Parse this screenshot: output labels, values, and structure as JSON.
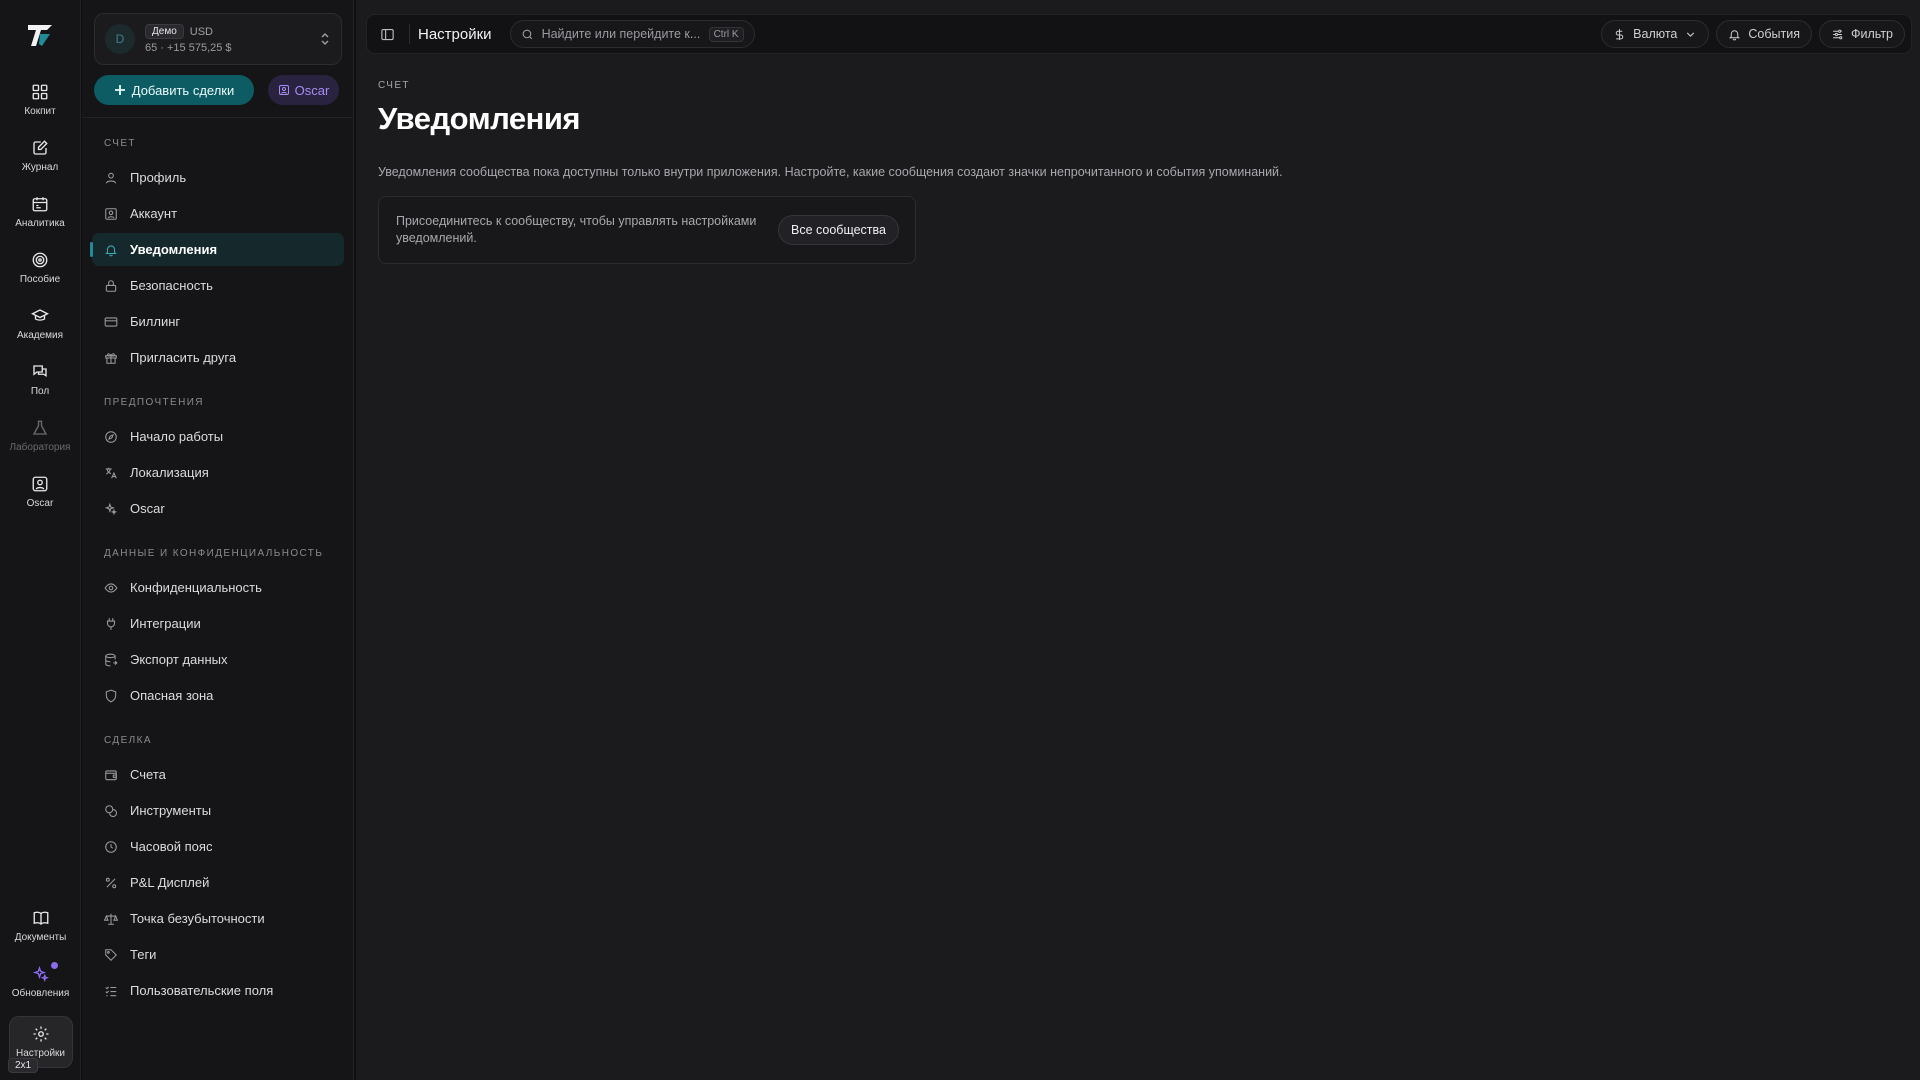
{
  "rail": {
    "items": [
      {
        "label": "Кокпит",
        "icon": "dashboard-icon"
      },
      {
        "label": "Журнал",
        "icon": "journal-icon"
      },
      {
        "label": "Аналитика",
        "icon": "calendar-icon"
      },
      {
        "label": "Пособие",
        "icon": "target-icon"
      },
      {
        "label": "Академия",
        "icon": "graduation-cap-icon"
      },
      {
        "label": "Пол",
        "icon": "chat-icon"
      },
      {
        "label": "Лаборатория",
        "icon": "flask-icon"
      },
      {
        "label": "Oscar",
        "icon": "oscar-icon"
      }
    ],
    "bottom": [
      {
        "label": "Документы",
        "icon": "book-icon"
      },
      {
        "label": "Обновления",
        "icon": "sparkles-icon"
      },
      {
        "label": "Настройки",
        "icon": "gear-icon"
      }
    ],
    "zoom_badge": "2x1"
  },
  "account": {
    "avatar_letter": "D",
    "mode": "Демо",
    "currency": "USD",
    "summary": "65 · +15 575,25 $"
  },
  "actions": {
    "add_trades": "Добавить сделки",
    "oscar": "Oscar"
  },
  "sidebar": {
    "sections": [
      {
        "title": "Счет",
        "items": [
          "Профиль",
          "Аккаунт",
          "Уведомления",
          "Безопасность",
          "Биллинг",
          "Пригласить друга"
        ]
      },
      {
        "title": "Предпочтения",
        "items": [
          "Начало работы",
          "Локализация",
          "Oscar"
        ]
      },
      {
        "title": "Данные и конфиденциальность",
        "items": [
          "Конфиденциальность",
          "Интеграции",
          "Экспорт данных",
          "Опасная зона"
        ]
      },
      {
        "title": "Сделка",
        "items": [
          "Счета",
          "Инструменты",
          "Часовой пояс",
          "P&L Дисплей",
          "Точка безубыточности",
          "Теги",
          "Пользовательские поля"
        ]
      }
    ],
    "active_item": "Уведомления"
  },
  "topbar": {
    "title": "Настройки",
    "search_placeholder": "Найдите или перейдите к...",
    "search_shortcut": "Ctrl K",
    "currency": "Валюта",
    "events": "События",
    "filter": "Фильтр"
  },
  "page": {
    "eyebrow": "СЧЕТ",
    "title": "Уведомления",
    "description": "Уведомления сообщества пока доступны только внутри приложения. Настройте, какие сообщения создают значки непрочитанного и события упоминаний.",
    "card_text": "Присоединитесь к сообществу, чтобы управлять настройками уведомлений.",
    "card_button": "Все сообщества"
  },
  "colors": {
    "accent": "#0d5b63",
    "oscar": "#a58cf2",
    "active_bar": "#1f8c98"
  }
}
